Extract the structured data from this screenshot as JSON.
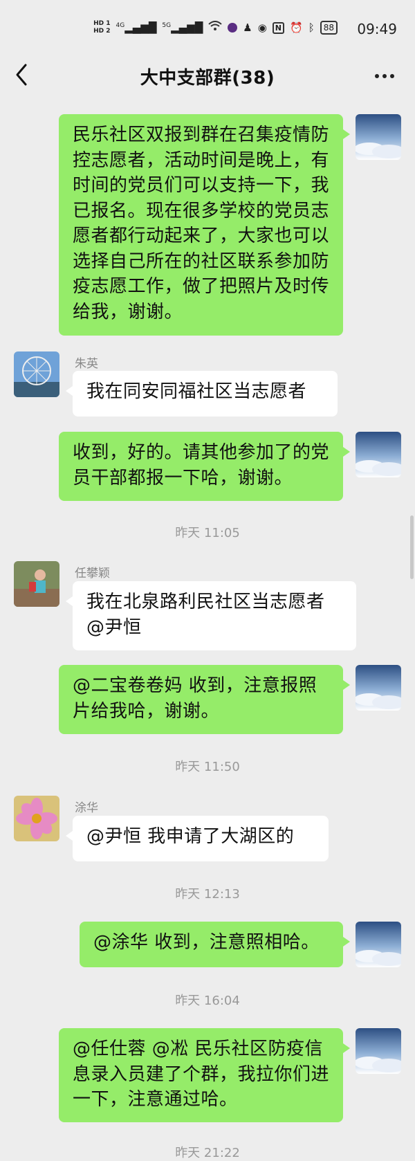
{
  "status_bar": {
    "hd1": "HD 1",
    "hd2": "HD 2",
    "signal1": "4G",
    "signal2": "5G",
    "battery": "88",
    "time": "09:49"
  },
  "nav": {
    "title": "大中支部群(38)"
  },
  "messages": [
    {
      "from": "me",
      "text": "民乐社区双报到群在召集疫情防控志愿者，活动时间是晚上，有时间的党员们可以支持一下，我已报名。现在很多学校的党员志愿者都行动起来了，大家也可以选择自己所在的社区联系参加防疫志愿工作，做了把照片及时传给我，谢谢。"
    },
    {
      "from": "other",
      "sender": "朱英",
      "text": "我在同安同福社区当志愿者"
    },
    {
      "from": "me",
      "text": "收到，好的。请其他参加了的党员干部都报一下哈，谢谢。"
    },
    {
      "timestamp": "昨天 11:05"
    },
    {
      "from": "other",
      "sender": "任攀颖",
      "text": "我在北泉路利民社区当志愿者@尹恒"
    },
    {
      "from": "me",
      "text": "@二宝卷卷妈  收到，注意报照片给我哈，谢谢。"
    },
    {
      "timestamp": "昨天 11:50"
    },
    {
      "from": "other",
      "sender": "涂华",
      "text": "@尹恒  我申请了大湖区的"
    },
    {
      "timestamp": "昨天 12:13"
    },
    {
      "from": "me",
      "text": "@涂华  收到，注意照相哈。"
    },
    {
      "timestamp": "昨天 16:04"
    },
    {
      "from": "me",
      "text": "@任仕蓉 @凇  民乐社区防疫信息录入员建了个群，我拉你们进一下，注意通过哈。"
    },
    {
      "timestamp": "昨天 21:22"
    }
  ]
}
